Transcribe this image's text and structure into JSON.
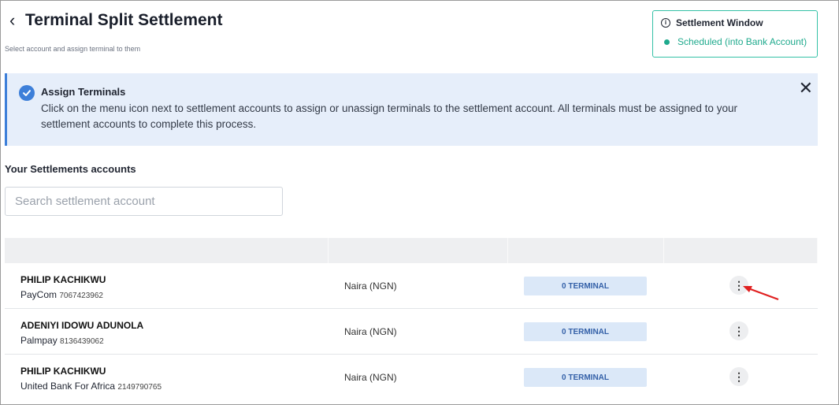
{
  "header": {
    "back_glyph": "‹",
    "title": "Terminal Split Settlement",
    "subtitle": "Select account and assign terminal to them"
  },
  "settlement_window": {
    "title": "Settlement Window",
    "status": "Scheduled (into Bank Account)",
    "status_color": "#1faa8d"
  },
  "banner": {
    "title": "Assign Terminals",
    "text": "Click on the menu icon next to settlement accounts to assign or unassign terminals to the settlement account. All terminals must be assigned to your settlement accounts to complete this process.",
    "close_glyph": "✕",
    "accent": "#3d7fd9"
  },
  "accounts_section": {
    "title": "Your Settlements accounts",
    "search_placeholder": "Search settlement account"
  },
  "accounts": [
    {
      "name": "PHILIP KACHIKWU",
      "bank": "PayCom",
      "number": "7067423962",
      "currency": "Naira (NGN)",
      "terminals": "0 TERMINAL"
    },
    {
      "name": "ADENIYI IDOWU ADUNOLA",
      "bank": "Palmpay",
      "number": "8136439062",
      "currency": "Naira (NGN)",
      "terminals": "0 TERMINAL"
    },
    {
      "name": "PHILIP KACHIKWU",
      "bank": "United Bank For Africa",
      "number": "2149790765",
      "currency": "Naira (NGN)",
      "terminals": "0 TERMINAL"
    }
  ],
  "menu_glyph": "⋮",
  "annotation_color": "#e02020"
}
